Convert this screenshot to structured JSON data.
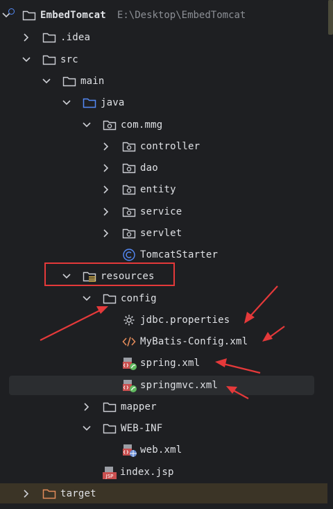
{
  "project": {
    "name": "EmbedTomcat",
    "path": "E:\\Desktop\\EmbedTomcat"
  },
  "tree": {
    "idea": ".idea",
    "src": "src",
    "main": "main",
    "java": "java",
    "package": "com.mmg",
    "controller": "controller",
    "dao": "dao",
    "entity": "entity",
    "service": "service",
    "servlet": "servlet",
    "tomcat_starter": "TomcatStarter",
    "resources": "resources",
    "config": "config",
    "jdbc_properties": "jdbc.properties",
    "mybatis_config": "MyBatis-Config.xml",
    "spring_xml": "spring.xml",
    "springmvc_xml": "springmvc.xml",
    "mapper": "mapper",
    "web_inf": "WEB-INF",
    "web_xml": "web.xml",
    "index_jsp": "index.jsp",
    "target": "target"
  },
  "icons": {
    "folder": "folder-icon",
    "source_root": "source-folder-icon",
    "package": "package-icon",
    "resources_root": "resources-folder-icon",
    "class": "class-icon",
    "properties": "gear-icon",
    "xml": "xml-icon",
    "spring": "spring-xml-icon",
    "web": "web-xml-icon",
    "jsp": "jsp-icon",
    "excluded": "excluded-folder-icon"
  },
  "colors": {
    "background": "#1e1f22",
    "selected_row": "#2b2d30",
    "excluded_row": "#3b3426",
    "annotation_red": "#e5393a",
    "source_blue": "#548af7",
    "class_blue": "#548af7",
    "xml_orange": "#e38b5a",
    "excluded_orange": "#e38b5a"
  }
}
